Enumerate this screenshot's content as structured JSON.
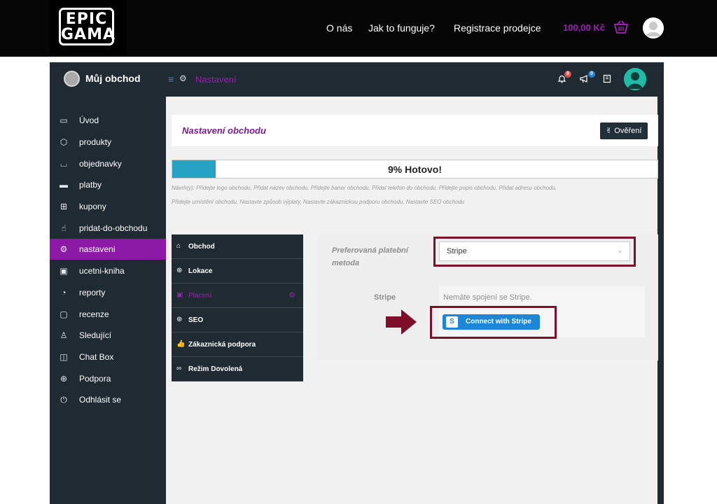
{
  "site": {
    "logo": {
      "line1": "EPIC",
      "line2": "GAMA"
    },
    "nav": [
      "O nás",
      "Jak to funguje?",
      "Registrace prodejce"
    ],
    "cart_amount": "100,00 Kč"
  },
  "dashboard": {
    "store_name": "Můj obchod",
    "breadcrumb": "Nastavení",
    "notifications_badge": "0",
    "announcements_badge": "0"
  },
  "sidebar": {
    "items": [
      {
        "label": "Úvod",
        "icon": "monitor-icon"
      },
      {
        "label": "produkty",
        "icon": "box-icon"
      },
      {
        "label": "objednavky",
        "icon": "cart-icon"
      },
      {
        "label": "platby",
        "icon": "credit-card-icon"
      },
      {
        "label": "kupony",
        "icon": "gift-icon"
      },
      {
        "label": "pridat-do-obchodu",
        "icon": "pointer-icon"
      },
      {
        "label": "nastaveni",
        "icon": "gears-icon"
      },
      {
        "label": "ucetni-kniha",
        "icon": "money-icon"
      },
      {
        "label": "reporty",
        "icon": "chart-pie-icon"
      },
      {
        "label": "recenze",
        "icon": "comment-icon"
      },
      {
        "label": "Sledující",
        "icon": "shirt-icon"
      },
      {
        "label": "Chat Box",
        "icon": "chat-icon"
      },
      {
        "label": "Podpora",
        "icon": "support-icon"
      },
      {
        "label": "Odhlásit se",
        "icon": "power-icon"
      }
    ],
    "active_index": 6
  },
  "panel": {
    "title": "Nastavení obchodu",
    "verify_button": "Ověření",
    "progress": {
      "percent": 9,
      "label": "9% Hotovo!"
    },
    "suggestions": "Návrh(y): Přidejte logo obchodu, Přidat název obchodu, Přidejte baner obchodu, Přidat telefon do obchodu, Přidejte popis obchodu, Přidat adresu obchodu, Přidejte umístění obchodu, Nastavte způsob výplaty, Nastavte zákaznickou podporu obchodu, Nastavte SEO obchodu"
  },
  "tabs": [
    {
      "label": "Obchod",
      "icon": "bag-icon"
    },
    {
      "label": "Lokace",
      "icon": "globe-icon"
    },
    {
      "label": "Placení",
      "icon": "money-icon",
      "active": true
    },
    {
      "label": "SEO",
      "icon": "globe-icon"
    },
    {
      "label": "Zákaznická podpora",
      "icon": "thumbs-up-icon"
    },
    {
      "label": "Režim Dovolená",
      "icon": "vacation-icon"
    }
  ],
  "payment": {
    "preferred_label": "Preferovaná platební metoda",
    "preferred_value": "Stripe",
    "stripe_label": "Stripe",
    "stripe_status": "Nemáte spojení se Stripe.",
    "connect_button": "Connect with Stripe",
    "connect_button_logo": "S"
  },
  "colors": {
    "accent": "#8d1aa6",
    "sidebar_bg": "#1f2a33",
    "progress_fill": "#25a2c4",
    "stripe_blue": "#1d86d6",
    "highlight": "#7d0f2a"
  }
}
